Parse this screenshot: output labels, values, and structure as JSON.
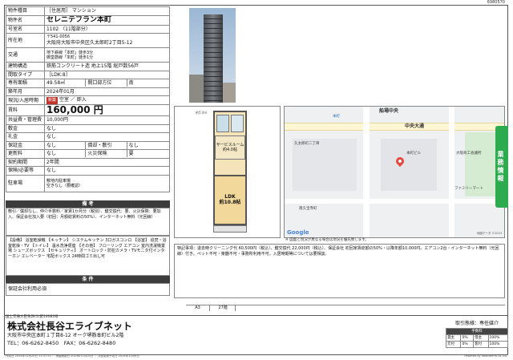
{
  "doc_id": "6980570",
  "rows": [
    {
      "k": "物件種目",
      "v": "［住居用］ マンション"
    },
    {
      "k": "物件名",
      "v": "セレニテフラン本町"
    },
    {
      "k": "号室名",
      "v": "1102 （11階部分）"
    },
    {
      "k": "所在地",
      "v": "大阪府大阪市中央区久太郎町2丁目5-12",
      "sub": "〒541-0056"
    },
    {
      "k": "交通",
      "v": "地下鉄線「本町」徒歩3分",
      "v2": "御堂筋線「本町」徒歩1分"
    },
    {
      "k": "建物構造",
      "v": "鉄筋コンクリート造 地上15階 総戸数56戸"
    },
    {
      "k": "間取タイプ",
      "v": "［LDK:8］"
    },
    {
      "k": "専有面積",
      "v": "49.58㎡",
      "mid_k": "開口部方位",
      "mid_v": "南"
    },
    {
      "k": "築年月",
      "v": "2024年01月"
    },
    {
      "k": "現況/入居時期",
      "v": "空室 ／ 即入",
      "badge": "新築"
    },
    {
      "k": "賃料",
      "v": "160,000 円"
    },
    {
      "k": "共益費・管理費",
      "v": "10,000円"
    },
    {
      "k": "敷金",
      "v": "なし"
    },
    {
      "k": "礼金",
      "v": "なし"
    },
    {
      "k": "保証金",
      "v": "なし",
      "mid_k": "償却・敷引",
      "mid_v": "なし"
    },
    {
      "k": "更新料",
      "v": "なし",
      "mid_k": "火災保険",
      "mid_v": "要"
    },
    {
      "k": "契約期間",
      "v": "2年間"
    },
    {
      "k": "保険/必要等",
      "v": "なし"
    },
    {
      "k": "駐車場",
      "v": "敷地内駐車場",
      "v2": "空きなし（要確認）"
    }
  ],
  "bikou_title": "備 考",
  "bikou_text": "敷引／償却なし、仲介手数料／家賃1か月分（税別）、鍵交換代：要、火災保険：要加入、保証会社加入要（初回：月額総賃料の50%）、インターネット無料（光回線）",
  "setsubi_text": "【設備】 浴室乾燥機 【キッチン】 システムキッチン 3口ガスコンロ 【浴室】 追焚・浴室乾燥・TV 【トイレ】 温水洗浄便座 【その他】 フローリング エアコン 室内洗濯機置場 シューズボックス 【セキュリティ】 オートロック・防犯カメラ・TVモニタ付インターホン エレベーター 宅配ボックス 24時間ゴミ出し可",
  "joken_title": "条 件",
  "joken_text": "保証会社利用必須",
  "floorplan": {
    "ldk_label": "LDK",
    "ldk_size": "約10.8帖",
    "service_label": "サービスルーム",
    "service_size": "約4.0帖",
    "dimensions": "約5.0m"
  },
  "map": {
    "labels": [
      "船場中央",
      "中央大通",
      "本町",
      "久太郎町二丁目",
      "本町ビル",
      "南久宝寺町",
      "大阪商工会議所",
      "ファミリーマート"
    ],
    "google": "Google",
    "attribution": "地図データ ©2023"
  },
  "notice": "※ 図面と現況が異なる場合は現況を優先致します。",
  "remarks": "特記事項：退去時クリーニング代 60,500円（税込）、鍵交換代 22,000円（税込）、保証会社 初回家賃総額の50%・以降年額10,000円。エアコン2台・インターネット無料（光回線）付き。ペット不可・楽器不可・事務所利用不可。入居時期等については要相談。",
  "remarks_strip": [
    "A3",
    "27階"
  ],
  "side_tab": "業務情報",
  "license": "国土交通大臣免許(1)第10083号",
  "company": "株式会社長谷エライブネット",
  "address": "大阪市中央区本町１丁目8-12 オーク堺筋本町ビル2階",
  "tel": "TEL：06-6262-8450　FAX：06-6262-8480",
  "deal_type": "取引態様：専任媒介",
  "fees": {
    "header": "手数料",
    "rows": [
      [
        "貸主",
        "0%",
        "借主",
        "100%"
      ],
      [
        "元付",
        "0%",
        "客付",
        "100%"
      ]
    ]
  },
  "print_left": "作成日 2024年11月25日 11:37:22 ／ 掲載開始日 2024年11月25日 ／ 次回更新予定日 2024年12月9日",
  "print_right": "Powered by RealNetPro co.,ltd."
}
